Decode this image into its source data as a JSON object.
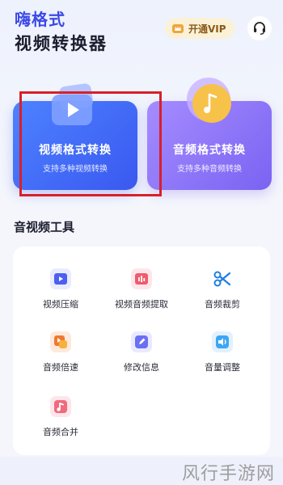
{
  "header": {
    "brand": "嗨格式",
    "title": "视频转换器",
    "vip_label": "开通VIP"
  },
  "cards": {
    "video": {
      "title": "视频格式转换",
      "subtitle": "支持多种视频转换"
    },
    "audio": {
      "title": "音频格式转换",
      "subtitle": "支持多种音频转换"
    }
  },
  "tools": {
    "section_title": "音视频工具",
    "items": [
      {
        "label": "视频压缩",
        "icon": "video-compress-icon",
        "color": "#4b5ff0"
      },
      {
        "label": "视频音频提取",
        "icon": "audio-extract-icon",
        "color": "#f05a6e"
      },
      {
        "label": "音频裁剪",
        "icon": "scissors-icon",
        "color": "#1e7fe0"
      },
      {
        "label": "音频倍速",
        "icon": "speed-icon",
        "color": "#f07a32"
      },
      {
        "label": "修改信息",
        "icon": "edit-icon",
        "color": "#6b6ff2"
      },
      {
        "label": "音量调整",
        "icon": "volume-icon",
        "color": "#3ea6f2"
      },
      {
        "label": "音频合并",
        "icon": "merge-icon",
        "color": "#f06a7e"
      }
    ]
  },
  "watermark": "风行手游网",
  "colors": {
    "brand": "#3b49e6",
    "video_card": "#3a58f0",
    "audio_card": "#7a63f2",
    "highlight": "#d8202a",
    "vip_bg": "#fbf1d7"
  }
}
